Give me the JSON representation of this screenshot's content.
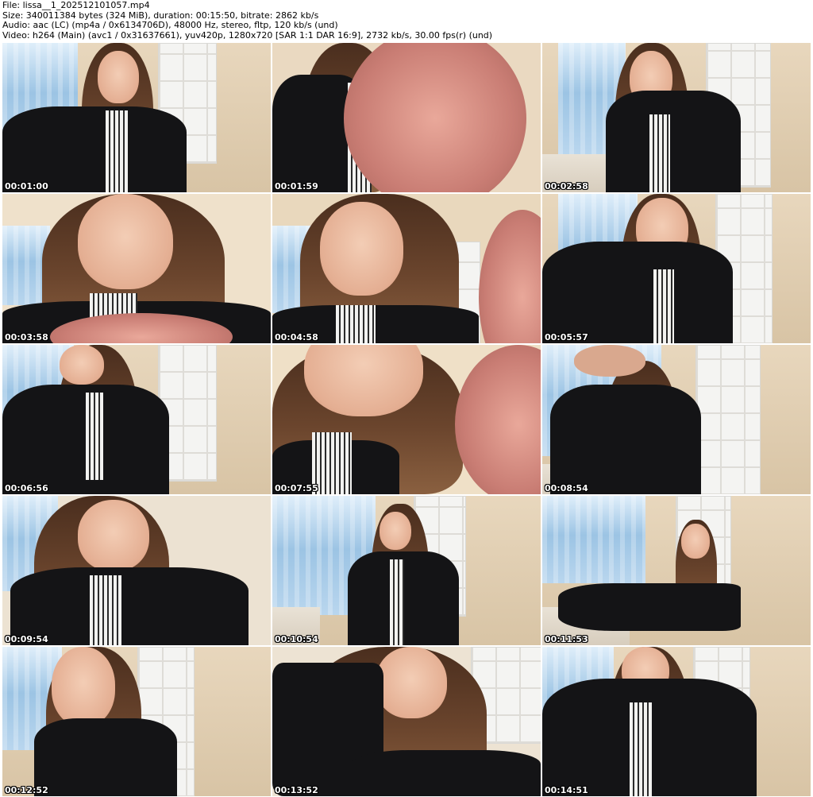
{
  "header": {
    "file_line": "File: lissa__1_202512101057.mp4",
    "size_line": "Size: 340011384 bytes (324 MiB), duration: 00:15:50, bitrate: 2862 kb/s",
    "audio_line": "Audio: aac (LC) (mp4a / 0x6134706D), 48000 Hz, stereo, fltp, 120 kb/s (und)",
    "video_line": "Video: h264 (Main) (avc1 / 0x31637661), yuv420p, 1280x720 [SAR 1:1 DAR 16:9], 2732 kb/s, 30.00 fps(r) (und)"
  },
  "thumbnails": [
    {
      "timestamp": "00:01:00"
    },
    {
      "timestamp": "00:01:59"
    },
    {
      "timestamp": "00:02:58"
    },
    {
      "timestamp": "00:03:58"
    },
    {
      "timestamp": "00:04:58"
    },
    {
      "timestamp": "00:05:57"
    },
    {
      "timestamp": "00:06:56"
    },
    {
      "timestamp": "00:07:55"
    },
    {
      "timestamp": "00:08:54"
    },
    {
      "timestamp": "00:09:54"
    },
    {
      "timestamp": "00:10:54"
    },
    {
      "timestamp": "00:11:53"
    },
    {
      "timestamp": "00:12:52"
    },
    {
      "timestamp": "00:13:52"
    },
    {
      "timestamp": "00:14:51"
    }
  ],
  "colors": {
    "background": "#ffffff",
    "header_text": "#000000",
    "timestamp_text": "#ffffff",
    "timestamp_outline": "#000000"
  }
}
